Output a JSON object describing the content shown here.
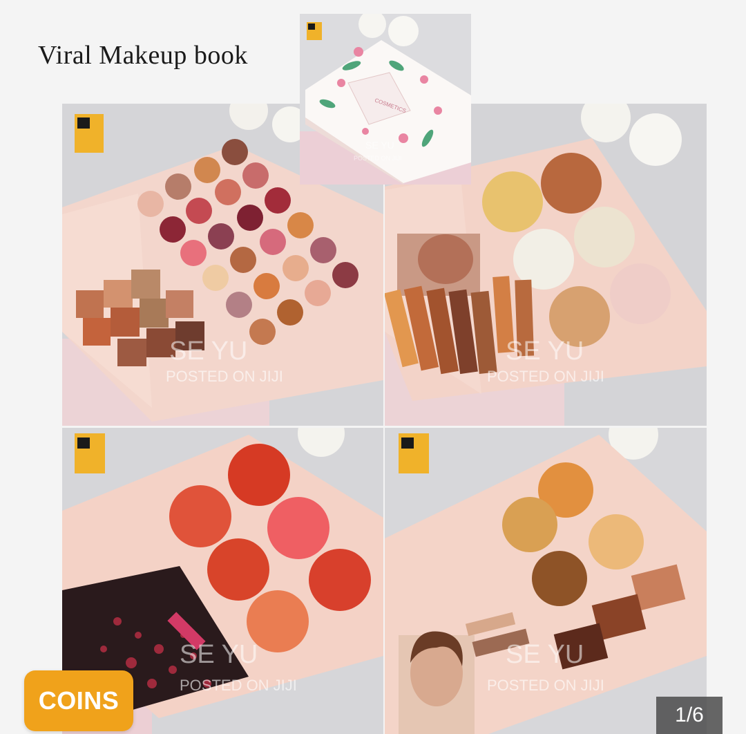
{
  "gallery": {
    "title": "Viral Makeup book",
    "watermark_line1": "SE YU",
    "watermark_line2": "POSTED ON JIJI",
    "box_label": "COSMETICS",
    "counter": "1/6",
    "coins_label": "COINS"
  },
  "colors": {
    "coins_bg": "#f0a21b",
    "counter_bg": "#464646",
    "palette_pink": "#f1d1c6"
  }
}
